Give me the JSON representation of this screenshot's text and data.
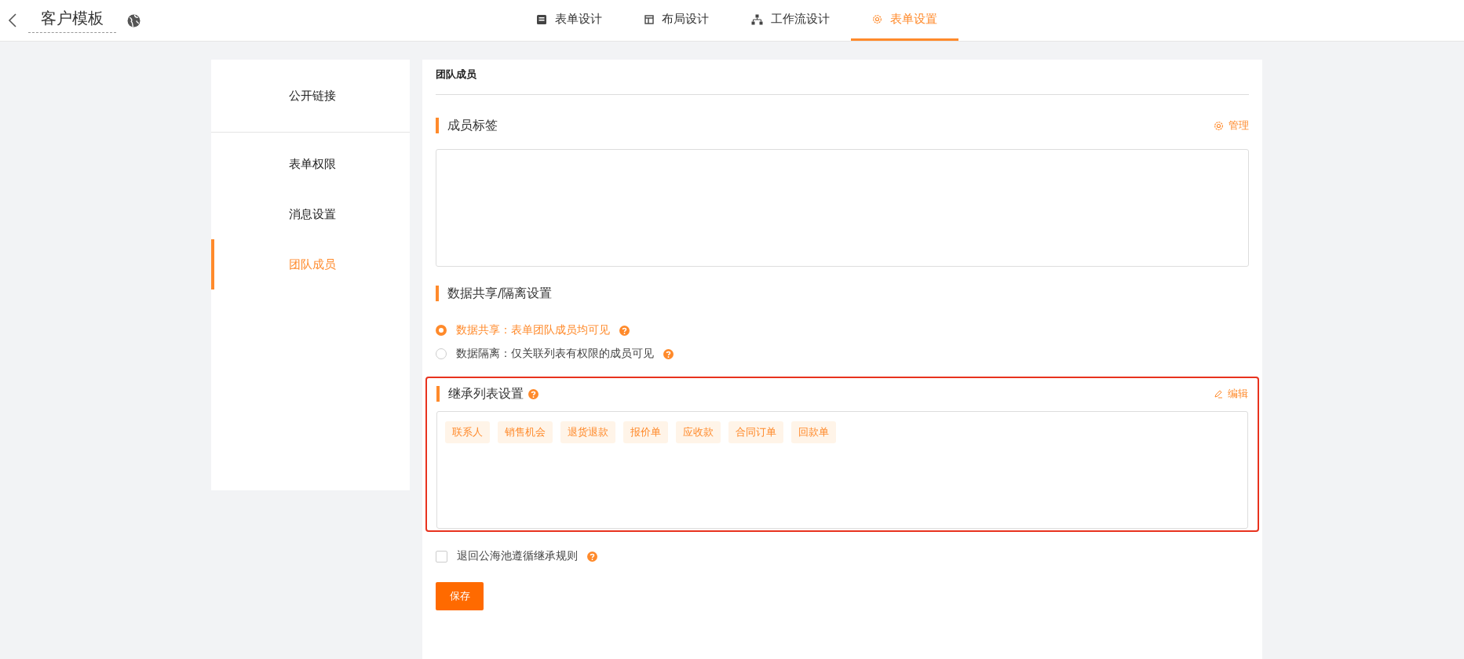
{
  "header": {
    "title": "客户模板",
    "tabs": [
      {
        "label": "表单设计",
        "selected": false
      },
      {
        "label": "布局设计",
        "selected": false
      },
      {
        "label": "工作流设计",
        "selected": false
      },
      {
        "label": "表单设置",
        "selected": true
      }
    ]
  },
  "sidebar": {
    "groups": [
      [
        {
          "label": "公开链接",
          "selected": false
        }
      ],
      [
        {
          "label": "表单权限",
          "selected": false
        },
        {
          "label": "消息设置",
          "selected": false
        },
        {
          "label": "团队成员",
          "selected": true
        }
      ]
    ]
  },
  "panel": {
    "title": "团队成员",
    "member_tags": {
      "title": "成员标签",
      "action": "管理"
    },
    "sharing": {
      "title": "数据共享/隔离设置",
      "options": [
        {
          "label": "数据共享：表单团队成员均可见",
          "selected": true
        },
        {
          "label": "数据隔离：仅关联列表有权限的成员可见",
          "selected": false
        }
      ]
    },
    "inherit": {
      "title": "继承列表设置",
      "action": "编辑",
      "highlighted": true,
      "tags": [
        "联系人",
        "销售机会",
        "退货退款",
        "报价单",
        "应收款",
        "合同订单",
        "回款单"
      ]
    },
    "rule": {
      "label": "退回公海池遵循继承规则",
      "checked": false
    },
    "save": "保存"
  }
}
